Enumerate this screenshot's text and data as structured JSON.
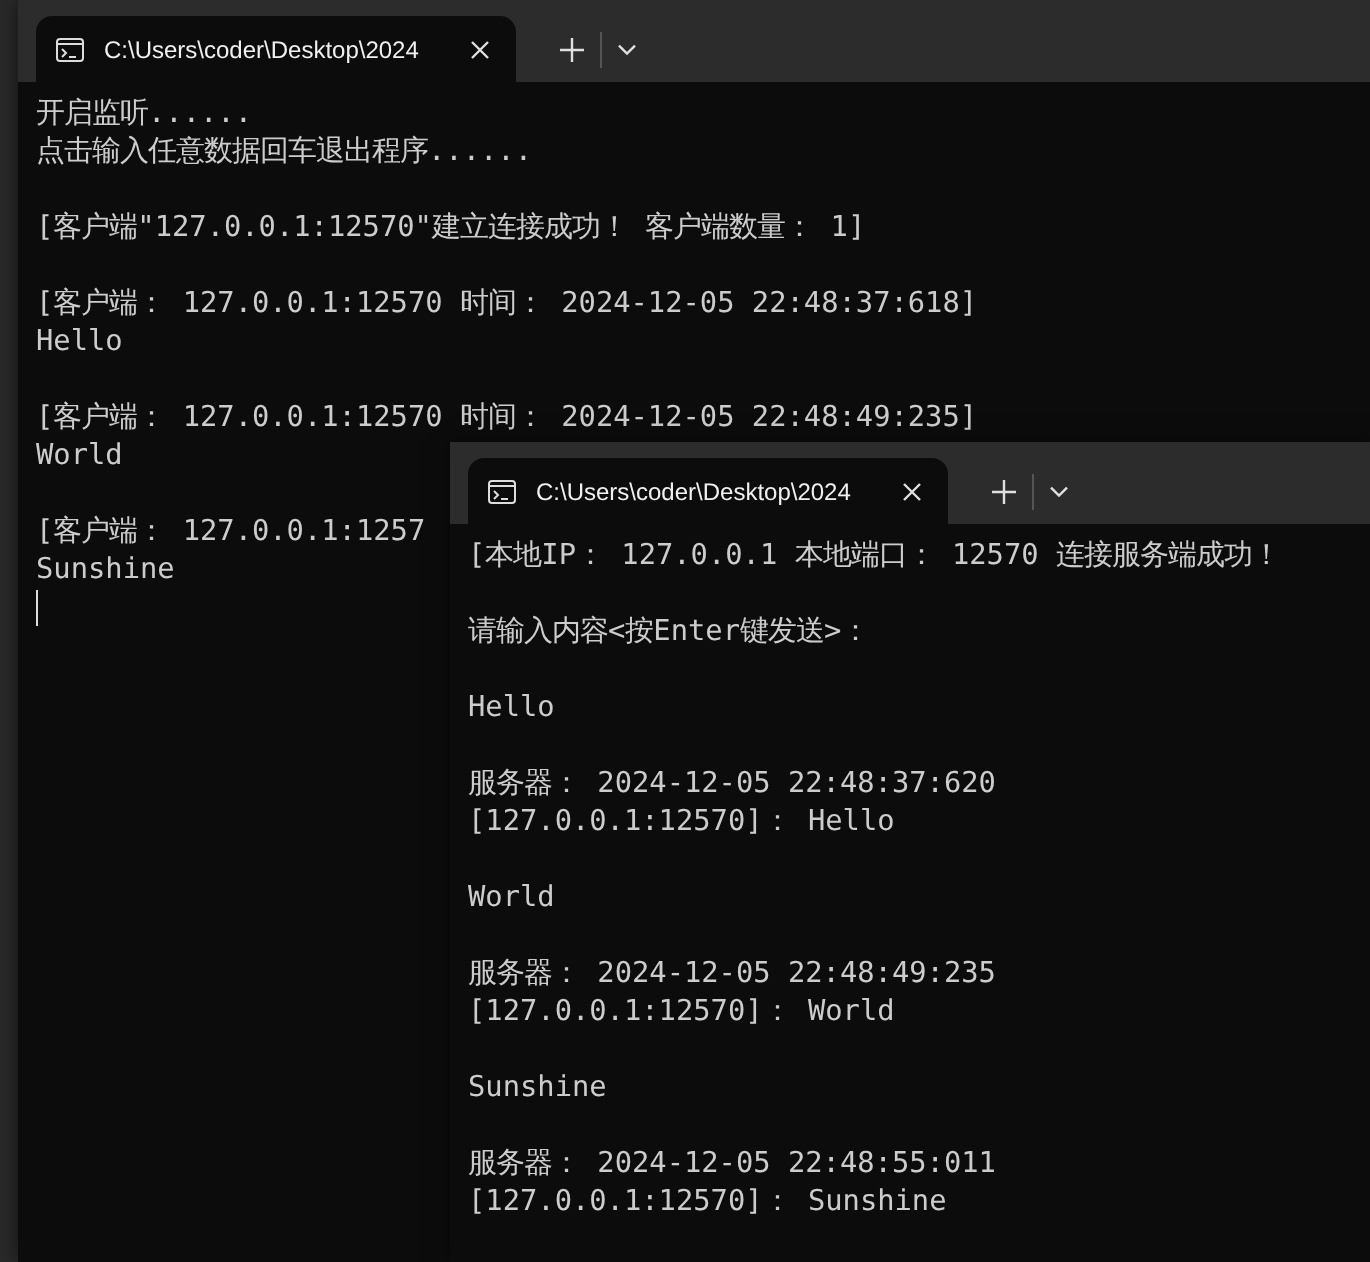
{
  "windows": [
    {
      "tab": {
        "title": "C:\\Users\\coder\\Desktop\\2024"
      },
      "cursor_visible": true,
      "blocks": [
        [
          "开启监听......",
          "点击输入任意数据回车退出程序......"
        ],
        [
          "[客户端\"127.0.0.1:12570\"建立连接成功！ 客户端数量： 1]"
        ],
        [
          "[客户端： 127.0.0.1:12570 时间： 2024-12-05 22:48:37:618]",
          "Hello"
        ],
        [
          "[客户端： 127.0.0.1:12570 时间： 2024-12-05 22:48:49:235]",
          "World"
        ],
        [
          "[客户端： 127.0.0.1:1257",
          "Sunshine"
        ]
      ]
    },
    {
      "tab": {
        "title": "C:\\Users\\coder\\Desktop\\2024"
      },
      "blocks": [
        [
          "[本地IP： 127.0.0.1 本地端口： 12570 连接服务端成功！"
        ],
        [
          "请输入内容<按Enter键发送>："
        ],
        [
          "Hello"
        ],
        [
          "服务器： 2024-12-05 22:48:37:620",
          "[127.0.0.1:12570]： Hello"
        ],
        [
          "World"
        ],
        [
          "服务器： 2024-12-05 22:48:49:235",
          "[127.0.0.1:12570]： World"
        ],
        [
          "Sunshine"
        ],
        [
          "服务器： 2024-12-05 22:48:55:011",
          "[127.0.0.1:12570]： Sunshine"
        ]
      ]
    }
  ]
}
